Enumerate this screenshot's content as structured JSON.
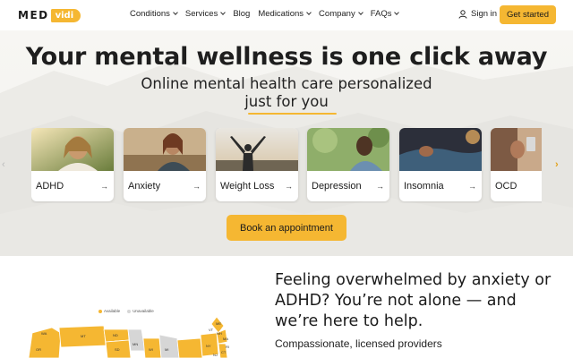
{
  "brand": {
    "logo_left": "MED",
    "logo_right": "vidi"
  },
  "nav": {
    "items": [
      {
        "label": "Conditions",
        "dropdown": true
      },
      {
        "label": "Services",
        "dropdown": true
      },
      {
        "label": "Blog",
        "dropdown": false
      },
      {
        "label": "Medications",
        "dropdown": true
      },
      {
        "label": "Company",
        "dropdown": true
      },
      {
        "label": "FAQs",
        "dropdown": true
      }
    ],
    "signin_label": "Sign in",
    "cta_label": "Get started"
  },
  "hero": {
    "title": "Your mental wellness is one click away",
    "subtitle_line1": "Online mental health care personalized",
    "subtitle_line2": "just for you",
    "book_label": "Book an appointment"
  },
  "conditions": [
    {
      "label": "ADHD",
      "arrow": "→"
    },
    {
      "label": "Anxiety",
      "arrow": "→"
    },
    {
      "label": "Weight Loss",
      "arrow": "→"
    },
    {
      "label": "Depression",
      "arrow": "→"
    },
    {
      "label": "Insomnia",
      "arrow": "→"
    },
    {
      "label": "OCD",
      "arrow": "→"
    }
  ],
  "carousel": {
    "prev_icon": "chevron-left-icon",
    "next_icon": "chevron-right-icon"
  },
  "map": {
    "legend": [
      {
        "label": "Available",
        "color": "#f5b732"
      },
      {
        "label": "Unavailable",
        "color": "#d6d6d6"
      }
    ],
    "state_labels": [
      "WA",
      "MT",
      "ND",
      "MN",
      "OR",
      "SD",
      "WI",
      "NY",
      "VT",
      "ME",
      "NH",
      "MA",
      "RI",
      "CT",
      "NJ",
      "MI"
    ]
  },
  "section": {
    "headline": "Feeling overwhelmed by anxiety or ADHD? You’re not alone — and we’re here to help.",
    "subline": "Compassionate, licensed providers"
  },
  "colors": {
    "accent": "#f5b732",
    "text": "#1b1b1b",
    "hero_bg": "#f5f4f0"
  }
}
